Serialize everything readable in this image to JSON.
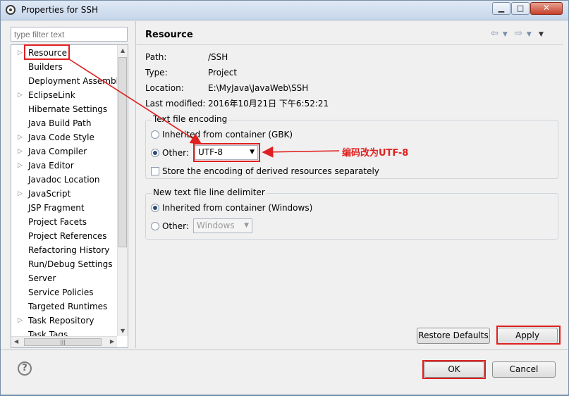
{
  "window": {
    "title": "Properties for SSH"
  },
  "filter": {
    "placeholder": "type filter text"
  },
  "tree": {
    "items": [
      {
        "label": "Resource",
        "expandable": true,
        "selected": true
      },
      {
        "label": "Builders",
        "expandable": false
      },
      {
        "label": "Deployment Assembly",
        "expandable": false
      },
      {
        "label": "EclipseLink",
        "expandable": true
      },
      {
        "label": "Hibernate Settings",
        "expandable": false
      },
      {
        "label": "Java Build Path",
        "expandable": false
      },
      {
        "label": "Java Code Style",
        "expandable": true
      },
      {
        "label": "Java Compiler",
        "expandable": true
      },
      {
        "label": "Java Editor",
        "expandable": true
      },
      {
        "label": "Javadoc Location",
        "expandable": false
      },
      {
        "label": "JavaScript",
        "expandable": true
      },
      {
        "label": "JSP Fragment",
        "expandable": false
      },
      {
        "label": "Project Facets",
        "expandable": false
      },
      {
        "label": "Project References",
        "expandable": false
      },
      {
        "label": "Refactoring History",
        "expandable": false
      },
      {
        "label": "Run/Debug Settings",
        "expandable": false
      },
      {
        "label": "Server",
        "expandable": false
      },
      {
        "label": "Service Policies",
        "expandable": false
      },
      {
        "label": "Targeted Runtimes",
        "expandable": false
      },
      {
        "label": "Task Repository",
        "expandable": true
      },
      {
        "label": "Task Tags",
        "expandable": false
      }
    ]
  },
  "page": {
    "title": "Resource",
    "info": {
      "path_label": "Path:",
      "path_value": "/SSH",
      "type_label": "Type:",
      "type_value": "Project",
      "location_label": "Location:",
      "location_value": "E:\\MyJava\\JavaWeb\\SSH",
      "modified_label": "Last modified:",
      "modified_value": "2016年10月21日 下午6:52:21"
    },
    "encoding_group": {
      "legend": "Text file encoding",
      "inherited_label": "Inherited from container (GBK)",
      "other_label": "Other:",
      "other_value": "UTF-8",
      "store_label": "Store the encoding of derived resources separately"
    },
    "delimiter_group": {
      "legend": "New text file line delimiter",
      "inherited_label": "Inherited from container (Windows)",
      "other_label": "Other:",
      "other_value": "Windows"
    },
    "restore_defaults": "Restore Defaults",
    "apply": "Apply"
  },
  "annotation": {
    "text": "编码改为UTF-8",
    "color": "#e02020"
  },
  "footer": {
    "ok": "OK",
    "cancel": "Cancel",
    "help": "?"
  }
}
